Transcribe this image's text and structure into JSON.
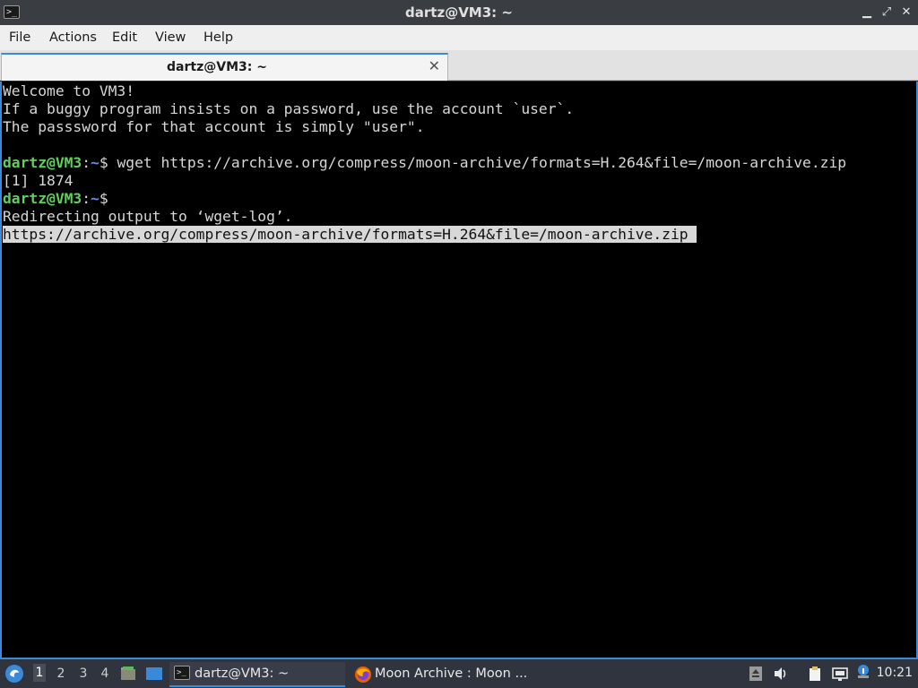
{
  "window": {
    "title": "dartz@VM3: ~",
    "minimize_glyph": "▁",
    "maximize_glyph": "⤢",
    "close_glyph": "✕"
  },
  "menu": [
    "File",
    "Actions",
    "Edit",
    "View",
    "Help"
  ],
  "tab": {
    "label": "dartz@VM3: ~",
    "close_glyph": "✕"
  },
  "terminal": {
    "lines": [
      "Welcome to VM3!",
      "If a buggy program insists on a password, use the account `user`.",
      "The passsword for that account is simply \"user\"."
    ],
    "prompt_user": "dartz@VM3",
    "prompt_sep": ":",
    "prompt_path": "~",
    "prompt_symbol": "$",
    "command": " wget https://archive.org/compress/moon-archive/formats=H.264&file=/moon-archive.zip",
    "job_line": "[1] 1874",
    "redirect_line": "Redirecting output to ‘wget-log’.",
    "selected_line": "https://archive.org/compress/moon-archive/formats=H.264&file=/moon-archive.zip "
  },
  "taskbar": {
    "workspaces": [
      "1",
      "2",
      "3",
      "4"
    ],
    "active_workspace": "1",
    "tasks": [
      {
        "label": "dartz@VM3: ~",
        "icon": "terminal-icon",
        "active": true
      },
      {
        "label": "Moon Archive : Moon ...",
        "icon": "firefox-icon",
        "active": false
      }
    ],
    "clock": "10:21",
    "tray_icons": [
      "removable-drive-icon",
      "volume-icon",
      "clipboard-icon",
      "network-icon"
    ]
  },
  "colors": {
    "accent": "#3a8ad8",
    "prompt_user": "#5ed15a",
    "prompt_path": "#6b8cf2",
    "terminal_bg": "#000000",
    "taskbar_bg": "#2f343f"
  }
}
